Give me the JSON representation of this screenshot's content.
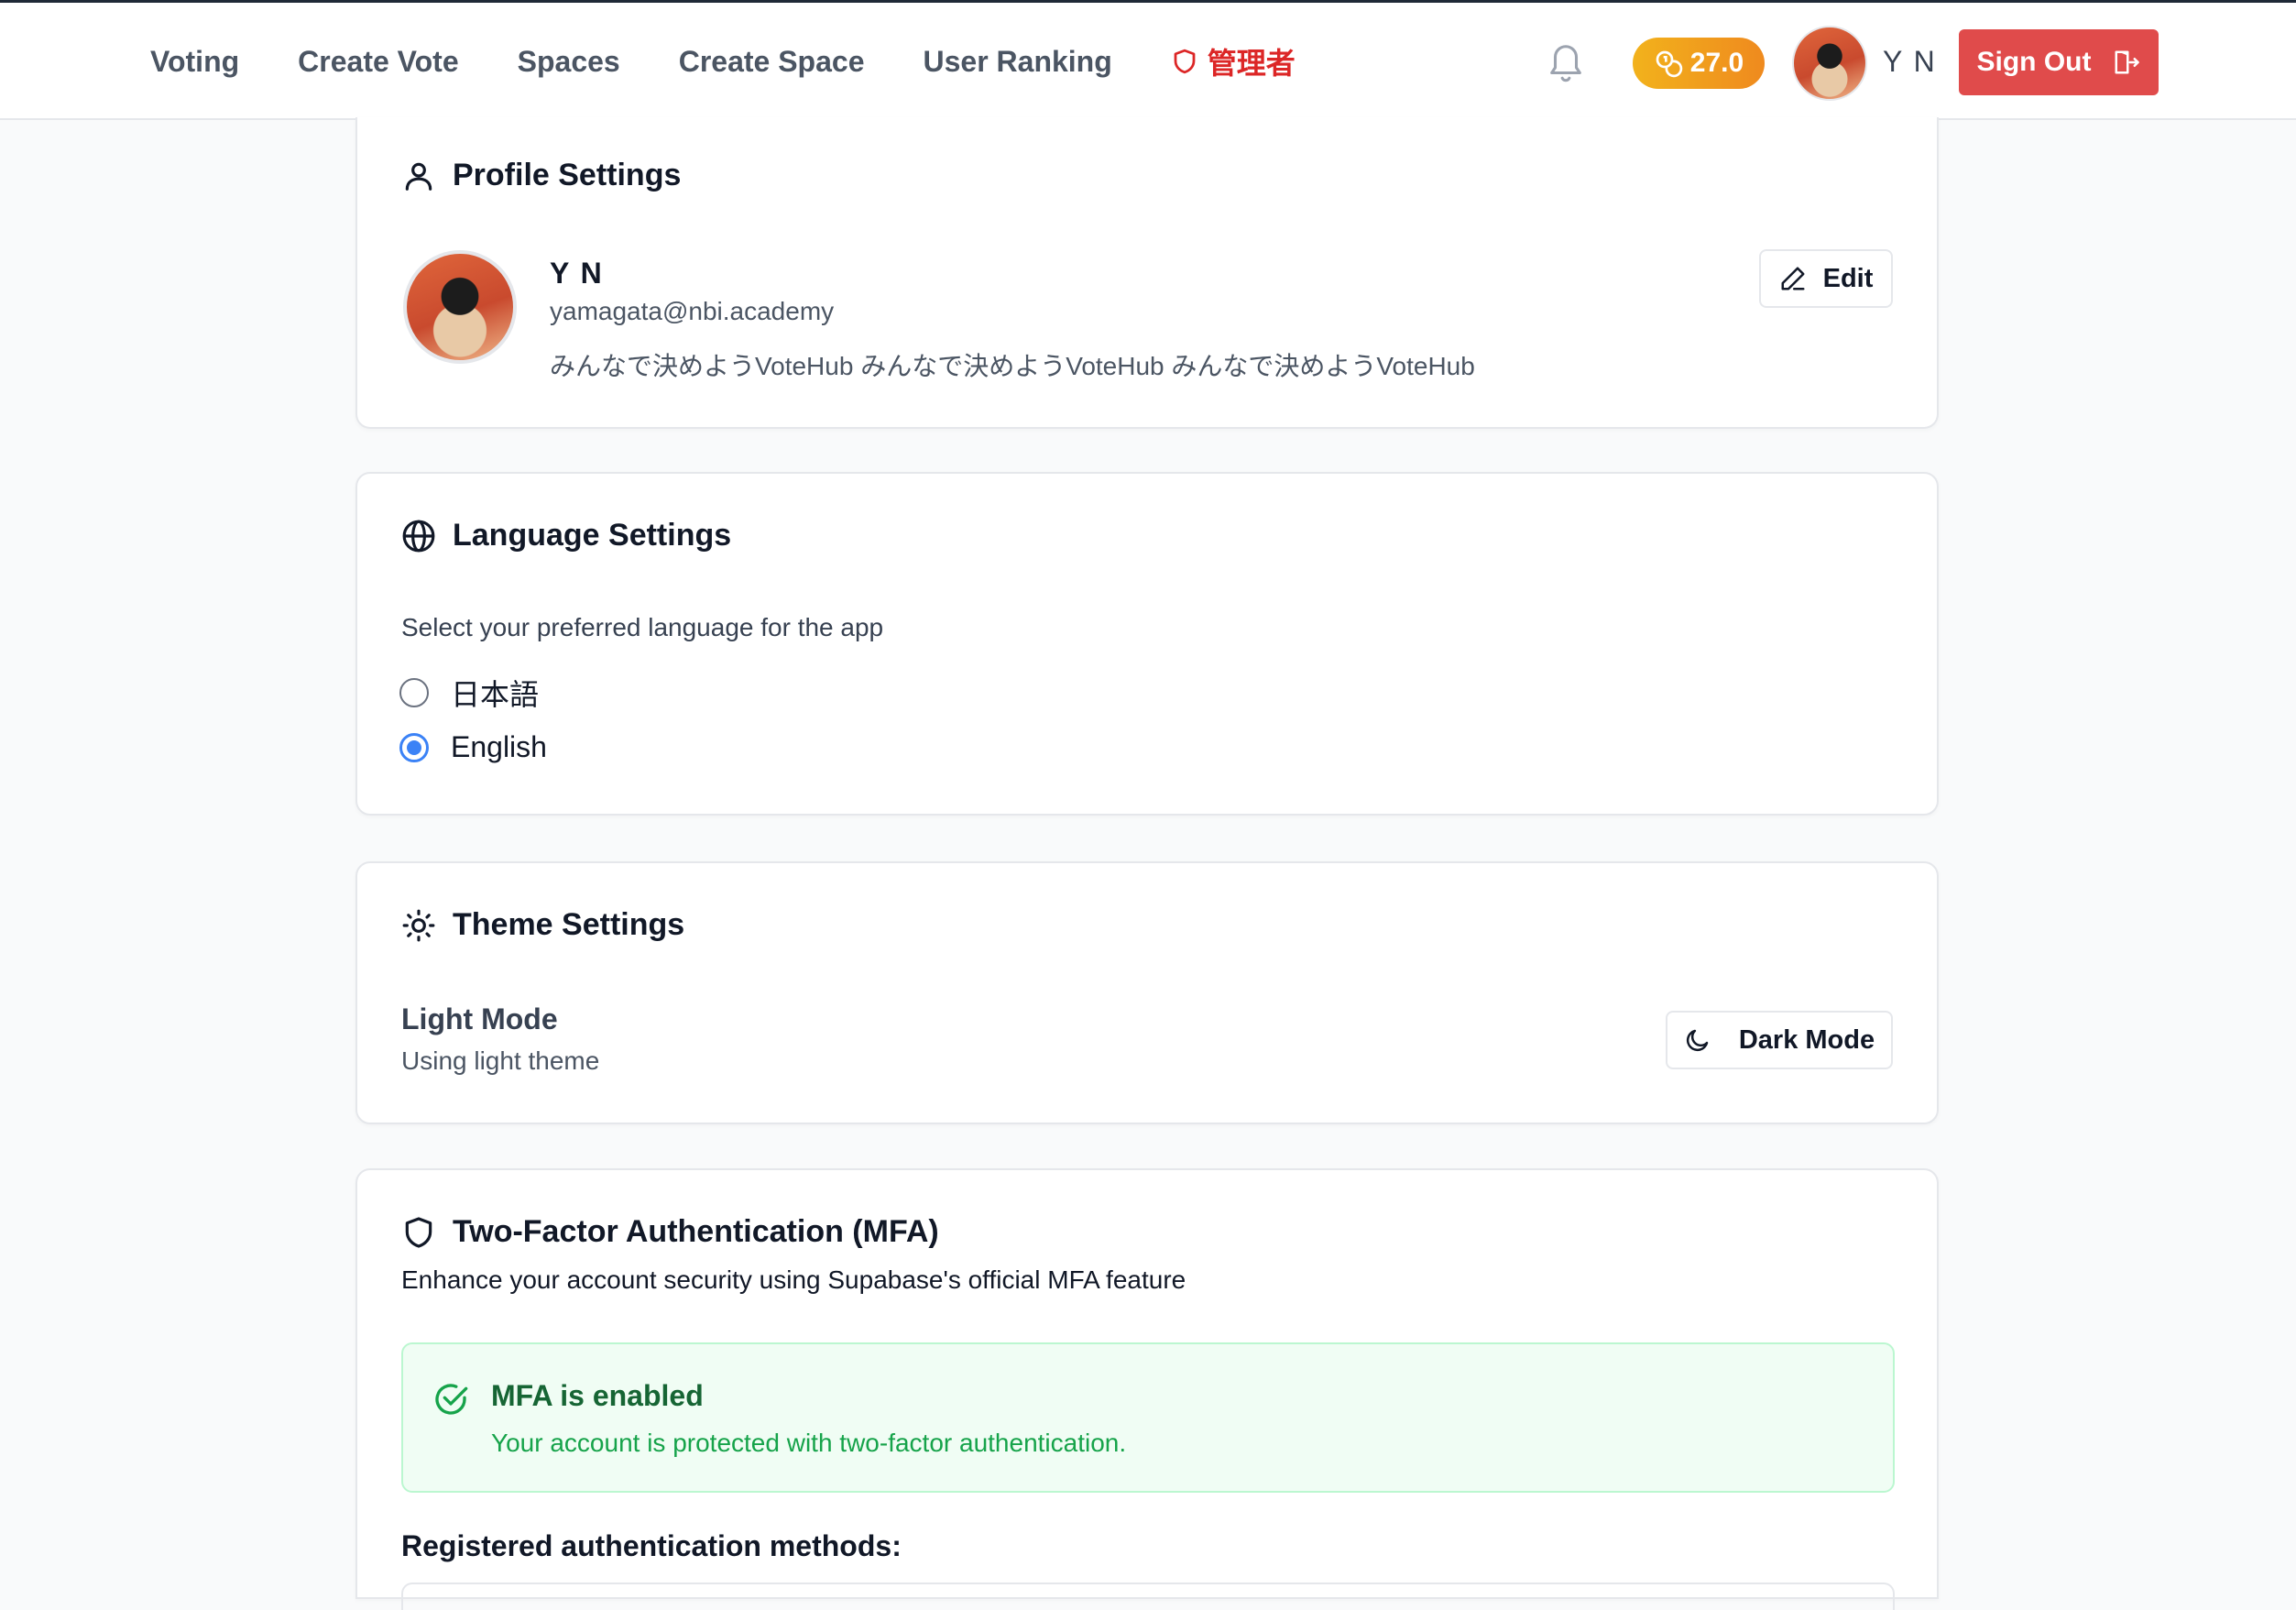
{
  "nav": {
    "items": [
      "Voting",
      "Create Vote",
      "Spaces",
      "Create Space",
      "User Ranking"
    ],
    "admin_label": "管理者"
  },
  "header": {
    "points": "27.0",
    "user_name": "Y N",
    "signout_label": "Sign Out"
  },
  "profile": {
    "title": "Profile Settings",
    "name": "Y N",
    "email": "yamagata@nbi.academy",
    "bio": "みんなで決めようVoteHub みんなで決めようVoteHub みんなで決めようVoteHub",
    "edit_label": "Edit"
  },
  "language": {
    "title": "Language Settings",
    "description": "Select your preferred language for the app",
    "options": [
      {
        "label": "日本語",
        "selected": false
      },
      {
        "label": "English",
        "selected": true
      }
    ]
  },
  "theme": {
    "title": "Theme Settings",
    "mode_title": "Light Mode",
    "mode_subtitle": "Using light theme",
    "toggle_label": "Dark Mode"
  },
  "mfa": {
    "title": "Two-Factor Authentication (MFA)",
    "description": "Enhance your account security using Supabase's official MFA feature",
    "status_title": "MFA is enabled",
    "status_subtitle": "Your account is protected with two-factor authentication.",
    "methods_title": "Registered authentication methods:"
  },
  "colors": {
    "accent_red": "#e04b4b",
    "points_orange": "#ef8a1e",
    "radio_blue": "#3b82f6",
    "success_green": "#16a34a"
  }
}
